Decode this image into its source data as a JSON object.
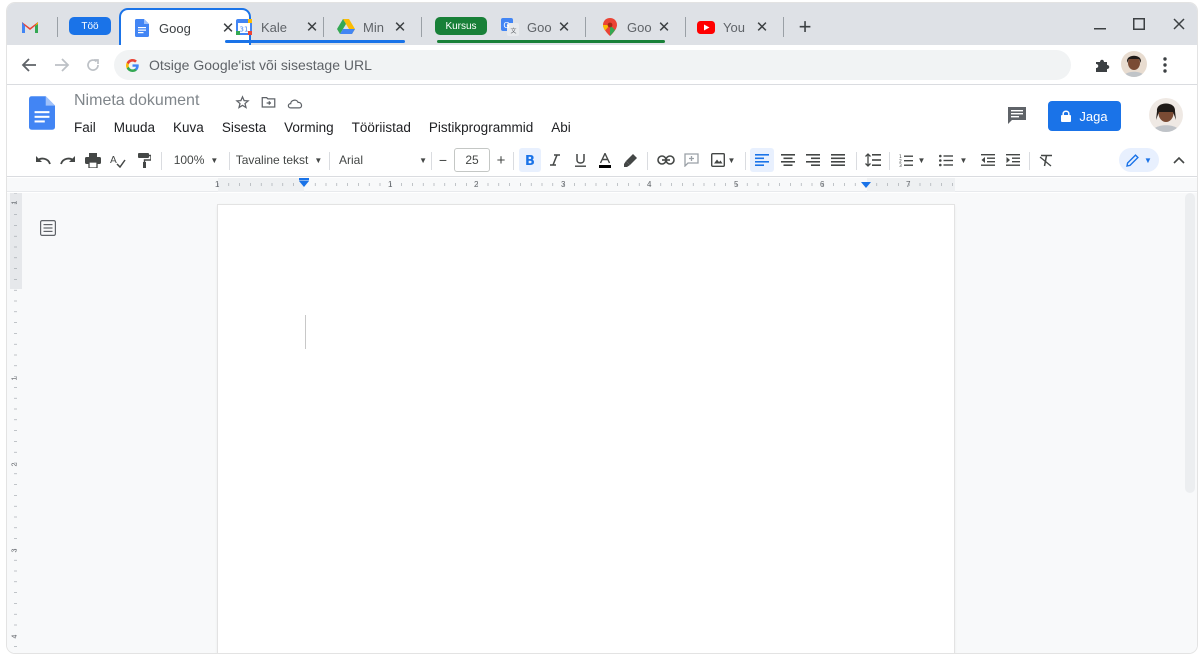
{
  "browser": {
    "tabs": [
      {
        "group_label": "Töö",
        "title": "Goog",
        "icon": "google-docs-icon",
        "active": true
      },
      {
        "title": "Kale",
        "icon": "google-calendar-icon"
      },
      {
        "title": "Min",
        "icon": "google-drive-icon"
      },
      {
        "group_label": "Kursus",
        "title": "Goo",
        "icon": "google-translate-icon"
      },
      {
        "title": "Goo",
        "icon": "google-maps-icon"
      },
      {
        "title": "You",
        "icon": "youtube-icon"
      }
    ],
    "new_tab_label": "+",
    "group_colors": {
      "Töö": "#1a73e8",
      "Kursus": "#188038"
    },
    "omnibox_placeholder": "Otsige Google'ist või sisestage URL"
  },
  "docs": {
    "title": "Nimeta dokument",
    "menu": [
      "Fail",
      "Muuda",
      "Kuva",
      "Sisesta",
      "Vorming",
      "Tööriistad",
      "Pistikprogrammid",
      "Abi"
    ],
    "share_label": "Jaga",
    "toolbar": {
      "zoom": "100%",
      "style": "Tavaline tekst",
      "font": "Arial",
      "font_size": "25",
      "minus": "−",
      "plus": "+"
    },
    "ruler_numbers": [
      "1",
      "1",
      "2",
      "3",
      "4",
      "5",
      "6",
      "7"
    ],
    "vruler_numbers": [
      "1",
      "1",
      "2",
      "3",
      "4"
    ],
    "accent": "#1a73e8"
  }
}
